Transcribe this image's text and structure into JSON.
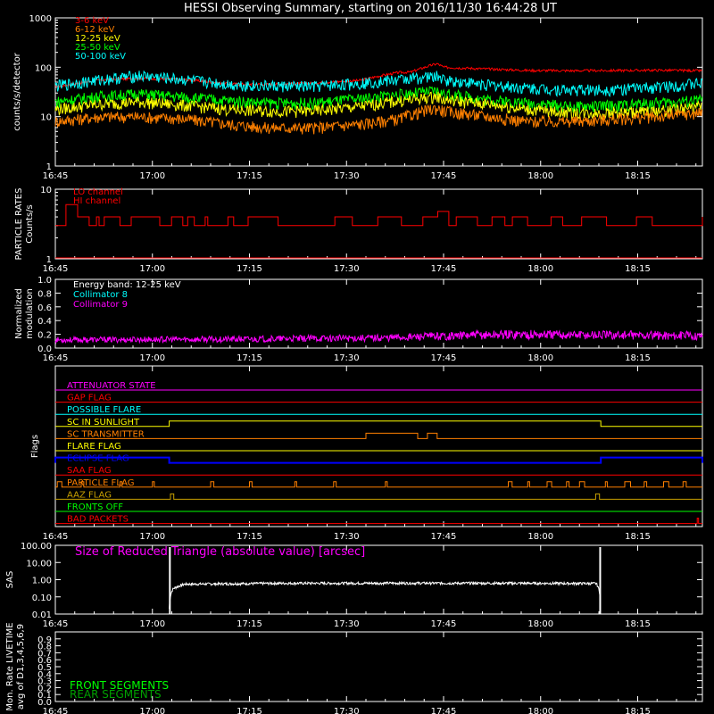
{
  "title": "HESSI Observing Summary, starting on 2016/11/30 16:44:28 UT",
  "colors": {
    "background": "#000000",
    "axes": "#ffffff",
    "red": "#ff0000",
    "orange": "#ff8000",
    "yellow": "#ffff00",
    "green": "#00ff00",
    "cyan": "#00ffff",
    "magenta": "#ff00ff",
    "blue": "#0000ff",
    "olive": "#c8a000",
    "darkgreen": "#00a000"
  },
  "time_axis": {
    "ticks": [
      "16:45",
      "17:00",
      "17:15",
      "17:30",
      "17:45",
      "18:00",
      "18:15"
    ],
    "range_min": [
      45,
      145
    ]
  },
  "chart_data": [
    {
      "type": "line",
      "name": "count-rates",
      "ylabel": "counts/s/detector",
      "yscale": "log",
      "ylim": [
        1,
        1000
      ],
      "yticks": [
        "1",
        "10",
        "100",
        "1000"
      ],
      "legend_position": "top-left",
      "x_minutes": [
        45,
        52,
        58,
        65,
        72,
        78,
        85,
        92,
        98,
        100,
        104,
        105,
        112,
        118,
        125,
        132,
        138,
        145
      ],
      "series": [
        {
          "name": "3-6 keV",
          "color": "#ff0000",
          "values": [
            40,
            55,
            60,
            56,
            46,
            45,
            48,
            54,
            78,
            80,
            118,
            100,
            92,
            86,
            85,
            86,
            87,
            85
          ]
        },
        {
          "name": "6-12 keV",
          "color": "#ff8000",
          "values": [
            8,
            10,
            10,
            9,
            7,
            6,
            6,
            7,
            9,
            11,
            15,
            13,
            10,
            8,
            8,
            9,
            10,
            12
          ]
        },
        {
          "name": "12-25 keV",
          "color": "#ffff00",
          "values": [
            14,
            18,
            20,
            17,
            14,
            13,
            13,
            16,
            21,
            22,
            26,
            22,
            18,
            14,
            12,
            12,
            13,
            16
          ]
        },
        {
          "name": "25-50 keV",
          "color": "#00ff00",
          "values": [
            20,
            26,
            29,
            25,
            21,
            19,
            19,
            23,
            28,
            30,
            33,
            29,
            22,
            19,
            16,
            17,
            19,
            22
          ]
        },
        {
          "name": "50-100 keV",
          "color": "#00ffff",
          "values": [
            42,
            56,
            68,
            56,
            45,
            42,
            41,
            48,
            56,
            60,
            66,
            56,
            44,
            38,
            35,
            36,
            40,
            48
          ]
        }
      ]
    },
    {
      "type": "line",
      "name": "particle-rates",
      "ylabel": "PARTICLE RATES Counts/s",
      "yscale": "log",
      "ylim": [
        1,
        10
      ],
      "yticks": [
        "1",
        "10"
      ],
      "series": [
        {
          "name": "LO channel",
          "color": "#ff0000"
        },
        {
          "name": "HI channel",
          "color": "#ff0000",
          "baseline": 3,
          "levels": [
            3,
            4
          ]
        }
      ]
    },
    {
      "type": "line",
      "name": "modulation",
      "ylabel": "Normalized modulation",
      "ylim": [
        0,
        1
      ],
      "yticks": [
        "0.0",
        "0.2",
        "0.4",
        "0.6",
        "0.8",
        "1.0"
      ],
      "annotation": "Energy band: 12-25 keV",
      "series": [
        {
          "name": "Collimator 8",
          "color": "#00ffff"
        },
        {
          "name": "Collimator 9",
          "color": "#ff00ff",
          "x_minutes": [
            45,
            75,
            95,
            115,
            145
          ],
          "values": [
            0.12,
            0.13,
            0.15,
            0.2,
            0.18
          ]
        }
      ]
    },
    {
      "type": "line",
      "name": "flags",
      "ylabel": "Flags",
      "flags": [
        {
          "name": "ATTENUATOR STATE",
          "color": "#ff00ff",
          "segments": []
        },
        {
          "name": "GAP FLAG",
          "color": "#ff0000",
          "segments": []
        },
        {
          "name": "POSSIBLE FLARE",
          "color": "#00ffff",
          "segments": []
        },
        {
          "name": "SC IN SUNLIGHT",
          "color": "#ffff00",
          "segments": [
            [
              62.6,
              129.3
            ]
          ]
        },
        {
          "name": "SC TRANSMITTER",
          "color": "#ff8000",
          "segments": [
            [
              93,
              101
            ],
            [
              102.5,
              104
            ]
          ]
        },
        {
          "name": "FLARE FLAG",
          "color": "#ffff00",
          "segments": []
        },
        {
          "name": "ECLIPSE FLAG",
          "color": "#0000ff",
          "segments": [
            [
              45,
              62.6
            ],
            [
              129.3,
              145
            ]
          ]
        },
        {
          "name": "SAA FLAG",
          "color": "#ff0000",
          "segments": []
        },
        {
          "name": "PARTICLE FLAG",
          "color": "#ff8000",
          "segments": [
            [
              45.3,
              46
            ],
            [
              49,
              49.4
            ],
            [
              55,
              55.3
            ],
            [
              60,
              60.3
            ],
            [
              69,
              69.5
            ],
            [
              75,
              75.4
            ],
            [
              82,
              82.3
            ],
            [
              88,
              88.4
            ],
            [
              96,
              96.3
            ],
            [
              115,
              115.6
            ],
            [
              118,
              118.3
            ],
            [
              121,
              121.7
            ],
            [
              124,
              124.4
            ],
            [
              126,
              126.8
            ],
            [
              130,
              130.3
            ],
            [
              133,
              133.9
            ],
            [
              136,
              136.4
            ],
            [
              139,
              139.8
            ],
            [
              142,
              142.5
            ]
          ]
        },
        {
          "name": "AAZ FLAG",
          "color": "#c8a000",
          "segments": [
            [
              62.8,
              63.3
            ],
            [
              128.5,
              129.1
            ]
          ]
        },
        {
          "name": "FRONTS OFF",
          "color": "#00ff00",
          "segments": []
        },
        {
          "name": "BAD PACKETS",
          "color": "#ff0000",
          "segments": [
            [
              144.2,
              144.4
            ]
          ]
        }
      ]
    },
    {
      "type": "line",
      "name": "sas",
      "ylabel": "SAS",
      "yscale": "log",
      "ylim": [
        0.01,
        100
      ],
      "yticks": [
        "0.01",
        "0.10",
        "1.00",
        "10.00",
        "100.00"
      ],
      "annotation": "Size of Reduced Triangle (absolute value) [arcsec]",
      "x_minutes": [
        62.6,
        63.2,
        65,
        80,
        100,
        120,
        128.6,
        129.3
      ],
      "values": [
        0.02,
        0.3,
        0.55,
        0.62,
        0.63,
        0.62,
        0.6,
        0.02
      ]
    },
    {
      "type": "line",
      "name": "livetime",
      "ylabel": "Mon. Rate LIVETIME avg of D1,3,4,5,6,9",
      "ylim": [
        0,
        1
      ],
      "yticks": [
        "0.0",
        "0.1",
        "0.2",
        "0.3",
        "0.4",
        "0.5",
        "0.6",
        "0.7",
        "0.8",
        "0.9"
      ],
      "series": [
        {
          "name": "FRONT SEGMENTS",
          "color": "#00ff00"
        },
        {
          "name": "REAR SEGMENTS",
          "color": "#00a000"
        }
      ]
    }
  ]
}
